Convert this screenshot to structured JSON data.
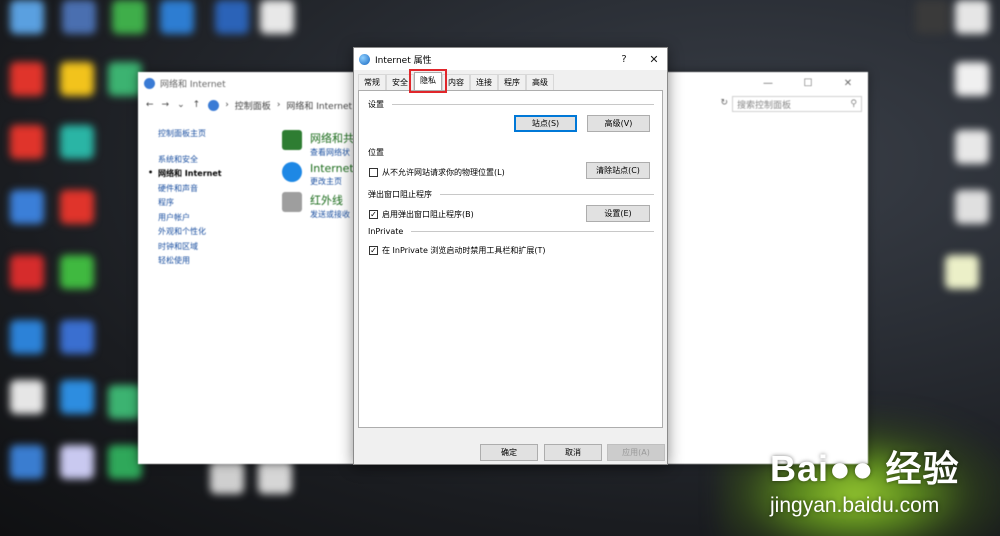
{
  "watermark": {
    "logo": "Bai●● 经验",
    "paw": "",
    "url": "jingyan.baidu.com"
  },
  "control_panel": {
    "window_title": "网络和 Internet",
    "window_buttons": [
      "—",
      "☐",
      "✕"
    ],
    "nav": {
      "back": "←",
      "forward": "→",
      "history": "⌄",
      "up": "↑"
    },
    "breadcrumb": [
      "控制面板",
      "网络和 Internet"
    ],
    "breadcrumb_sep": "›",
    "search_placeholder": "搜索控制面板",
    "search_icon": "⚲",
    "refresh_icon": "↻",
    "home_link": "控制面板主页",
    "sidebar": [
      "系统和安全",
      "网络和 Internet",
      "硬件和声音",
      "程序",
      "用户帐户",
      "外观和个性化",
      "时钟和区域",
      "轻松使用"
    ],
    "categories": [
      {
        "title": "网络和共",
        "sub": "查看网络状",
        "icon_color": "#2e7d32"
      },
      {
        "title": "Internet",
        "sub": "更改主页",
        "icon_color": "#1e88e5"
      },
      {
        "title": "红外线",
        "sub": "发送或接收",
        "icon_color": "#9e9e9e"
      }
    ]
  },
  "dialog": {
    "title": "Internet 属性",
    "help": "?",
    "close": "✕",
    "tabs": [
      "常规",
      "安全",
      "隐私",
      "内容",
      "连接",
      "程序",
      "高级"
    ],
    "active_tab": 2,
    "groups": {
      "settings": {
        "title": "设置",
        "sites_button": "站点(S)",
        "advanced_button": "高级(V)"
      },
      "location": {
        "title": "位置",
        "checkbox": "从不允许网站请求你的物理位置(L)",
        "checked": false,
        "clear_button": "清除站点(C)"
      },
      "popup": {
        "title": "弹出窗口阻止程序",
        "checkbox": "启用弹出窗口阻止程序(B)",
        "checked": true,
        "settings_button": "设置(E)"
      },
      "inprivate": {
        "title": "InPrivate",
        "checkbox": "在 InPrivate 浏览启动时禁用工具栏和扩展(T)",
        "checked": true
      }
    },
    "check_mark": "✓",
    "footer": {
      "ok": "确定",
      "cancel": "取消",
      "apply": "应用(A)"
    }
  }
}
